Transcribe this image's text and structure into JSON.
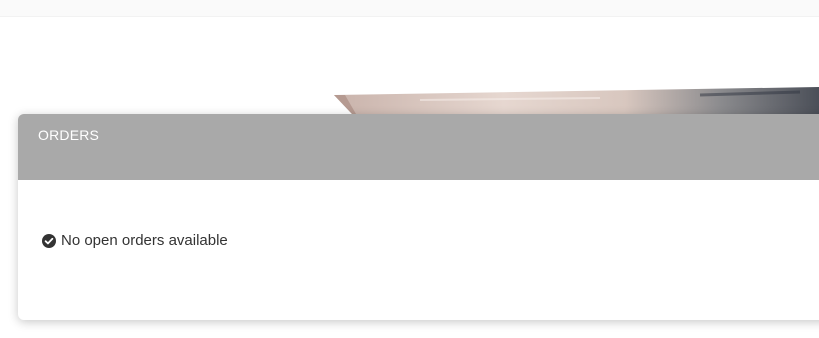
{
  "orders_panel": {
    "title": "ORDERS",
    "status_icon": "check-circle-icon",
    "status_text": "No open orders available"
  },
  "colors": {
    "header_bg": "#a9a9a9",
    "header_text": "#ffffff",
    "body_text": "#333333"
  }
}
